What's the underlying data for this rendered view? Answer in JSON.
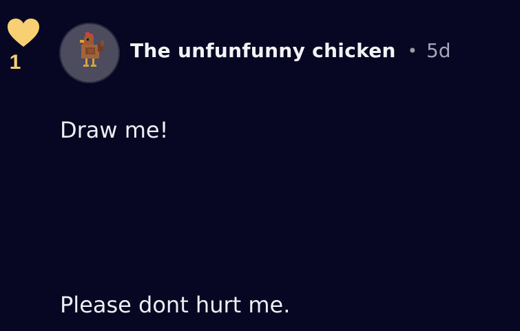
{
  "post": {
    "likes": "1",
    "author": "The unfunfunny chicken",
    "separator": "•",
    "time_ago": "5d",
    "body_lines": [
      "Draw me!",
      "Please dont hurt me."
    ]
  },
  "colors": {
    "background": "#070623",
    "heart": "#f8cf72",
    "text": "#eeeef4",
    "muted": "#a6a5b7",
    "avatar_bg": "#4d4b5e"
  },
  "icons": {
    "like": "heart-icon",
    "avatar": "pixel-chicken-avatar"
  }
}
